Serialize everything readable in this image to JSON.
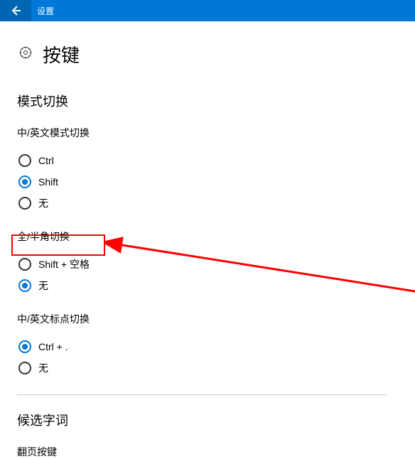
{
  "titlebar": {
    "title": "设置"
  },
  "page": {
    "title": "按键"
  },
  "sections": {
    "mode_switch": {
      "title": "模式切换",
      "groups": {
        "cn_en_mode": {
          "label": "中/英文模式切换",
          "options": [
            {
              "label": "Ctrl",
              "selected": false
            },
            {
              "label": "Shift",
              "selected": true
            },
            {
              "label": "无",
              "selected": false
            }
          ]
        },
        "full_half": {
          "label": "全/半角切换",
          "options": [
            {
              "label": "Shift + 空格",
              "selected": false
            },
            {
              "label": "无",
              "selected": true
            }
          ]
        },
        "cn_en_punct": {
          "label": "中/英文标点切换",
          "options": [
            {
              "label": "Ctrl + .",
              "selected": true
            },
            {
              "label": "无",
              "selected": false
            }
          ]
        }
      }
    },
    "candidate": {
      "title": "候选字词",
      "page_key_label": "翻页按键"
    }
  },
  "annotation": {
    "highlight_target": "Shift + 空格"
  }
}
